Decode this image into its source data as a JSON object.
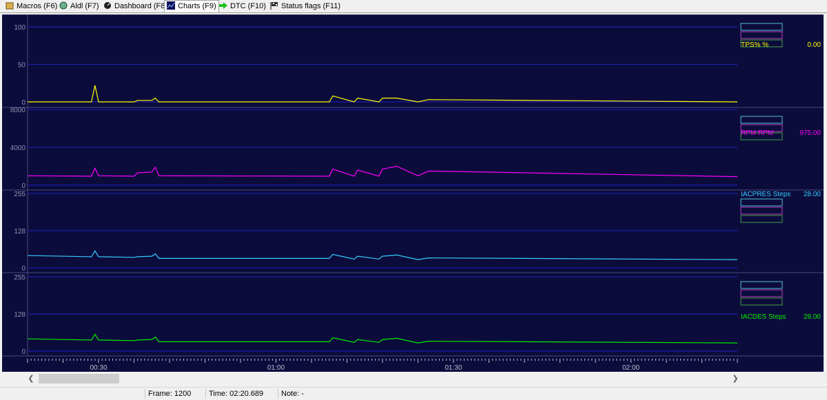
{
  "tabs": [
    {
      "label": "Macros (F6)",
      "icon": "macros-icon"
    },
    {
      "label": "Aldl (F7)",
      "icon": "aldl-icon"
    },
    {
      "label": "Dashboard (F8)",
      "icon": "dashboard-icon"
    },
    {
      "label": "Charts (F9)",
      "icon": "charts-icon",
      "active": true
    },
    {
      "label": "DTC (F10)",
      "icon": "dtc-arrow-icon"
    },
    {
      "label": "Status flags (F11)",
      "icon": "status-flags-icon"
    }
  ],
  "status": {
    "frame_label": "Frame:",
    "frame_value": "1200",
    "time_label": "Time:",
    "time_value": "02:20.689",
    "note_label": "Note:",
    "note_value": "-"
  },
  "chart_data": [
    {
      "type": "line",
      "ylim": [
        0,
        100
      ],
      "ytick_labels": [
        "100",
        "50",
        "0"
      ],
      "series_label": "TPS% %",
      "current_value": "0.00",
      "color": "#ffff00",
      "x": [
        0,
        18,
        19,
        20,
        30,
        31,
        35,
        36,
        37,
        85,
        86,
        92,
        93,
        99,
        100,
        104,
        110,
        113,
        200
      ],
      "values": [
        0,
        0,
        22,
        0,
        0,
        2,
        2,
        5,
        0,
        0,
        8,
        0,
        5,
        0,
        5,
        5,
        0,
        3,
        0
      ]
    },
    {
      "type": "line",
      "ylim": [
        0,
        8000
      ],
      "ytick_labels": [
        "8000",
        "4000",
        "0"
      ],
      "series_label": "RPM RPM",
      "current_value": "975.00",
      "color": "#ff00ff",
      "x": [
        0,
        18,
        19,
        20,
        30,
        31,
        35,
        36,
        37,
        85,
        86,
        92,
        93,
        99,
        100,
        104,
        110,
        113,
        200
      ],
      "values": [
        1000,
        950,
        1800,
        1000,
        950,
        1300,
        1400,
        1900,
        1000,
        950,
        1700,
        950,
        1600,
        950,
        1700,
        2000,
        1000,
        1500,
        900
      ]
    },
    {
      "type": "line",
      "ylim": [
        0,
        255
      ],
      "ytick_labels": [
        "255",
        "128",
        "0"
      ],
      "series_label": "IACPRES Steps",
      "current_value": "28.00",
      "color": "#33ccff",
      "x": [
        0,
        18,
        19,
        20,
        30,
        31,
        35,
        36,
        37,
        85,
        86,
        92,
        93,
        99,
        100,
        104,
        110,
        113,
        200
      ],
      "values": [
        42,
        38,
        58,
        38,
        36,
        38,
        40,
        48,
        32,
        32,
        46,
        30,
        40,
        30,
        40,
        44,
        28,
        34,
        28
      ]
    },
    {
      "type": "line",
      "ylim": [
        0,
        255
      ],
      "ytick_labels": [
        "255",
        "128",
        "0"
      ],
      "series_label": "IACDES Steps",
      "current_value": "28.00",
      "color": "#00ee00",
      "x": [
        0,
        18,
        19,
        20,
        30,
        31,
        35,
        36,
        37,
        85,
        86,
        92,
        93,
        99,
        100,
        104,
        110,
        113,
        200
      ],
      "values": [
        42,
        38,
        58,
        38,
        36,
        38,
        40,
        48,
        32,
        32,
        46,
        30,
        40,
        30,
        40,
        44,
        28,
        34,
        28
      ]
    }
  ],
  "time_axis": {
    "ticks": [
      "00:30",
      "01:00",
      "01:30",
      "02:00"
    ]
  },
  "legend_box_colors": [
    "#4fc1d9",
    "#c040c0",
    "#c0c040",
    "#40a040",
    "#c07030"
  ]
}
